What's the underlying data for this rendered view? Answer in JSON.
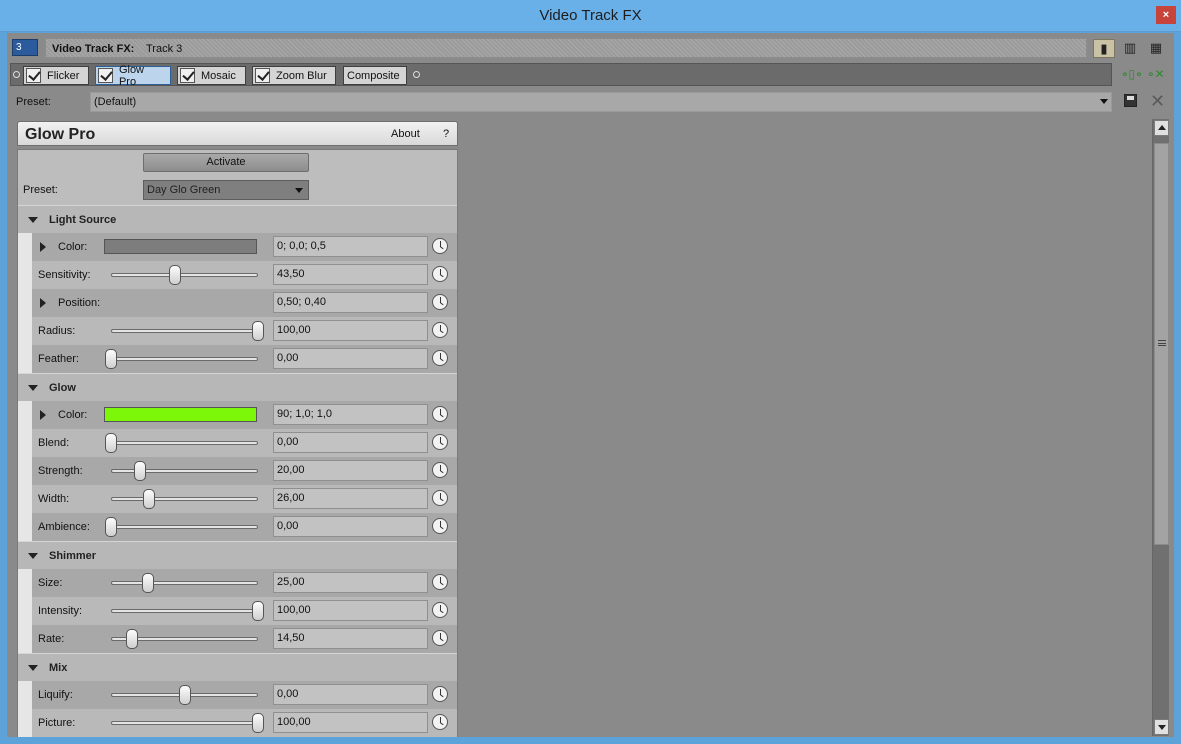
{
  "window": {
    "title": "Video Track FX",
    "close_glyph": "×"
  },
  "header": {
    "track_number": "3",
    "title": "Video Track FX:",
    "track_name": "Track 3"
  },
  "chain": {
    "effects": [
      {
        "label": "Flicker",
        "checked": true,
        "active": false
      },
      {
        "label": "Glow Pro",
        "checked": true,
        "active": true
      },
      {
        "label": "Mosaic",
        "checked": true,
        "active": false
      },
      {
        "label": "Zoom Blur",
        "checked": true,
        "active": false
      },
      {
        "label": "Composite",
        "checked": false,
        "active": false
      }
    ],
    "icons": [
      "plug-in-chain-icon",
      "remove-plugin-icon"
    ]
  },
  "preset_bar": {
    "label": "Preset:",
    "value": "(Default)"
  },
  "plugin": {
    "title": "Glow Pro",
    "about": "About",
    "help": "?",
    "activate": "Activate",
    "preset_label": "Preset:",
    "preset_value": "Day Glo Green",
    "sections": [
      {
        "name": "Light Source",
        "rows": [
          {
            "label": "Color:",
            "type": "color",
            "expandable": true,
            "color": "#7d7d7d",
            "value": "0; 0,0; 0,5"
          },
          {
            "label": "Sensitivity:",
            "type": "slider",
            "fraction": 0.435,
            "value": "43,50"
          },
          {
            "label": "Position:",
            "type": "text",
            "expandable": true,
            "value": "0,50; 0,40"
          },
          {
            "label": "Radius:",
            "type": "slider",
            "fraction": 1.0,
            "value": "100,00"
          },
          {
            "label": "Feather:",
            "type": "slider",
            "fraction": 0.0,
            "value": "0,00"
          }
        ]
      },
      {
        "name": "Glow",
        "rows": [
          {
            "label": "Color:",
            "type": "color",
            "expandable": true,
            "color": "#7cf70a",
            "value": "90; 1,0; 1,0"
          },
          {
            "label": "Blend:",
            "type": "slider",
            "fraction": 0.0,
            "value": "0,00"
          },
          {
            "label": "Strength:",
            "type": "slider",
            "fraction": 0.2,
            "value": "20,00"
          },
          {
            "label": "Width:",
            "type": "slider",
            "fraction": 0.26,
            "value": "26,00"
          },
          {
            "label": "Ambience:",
            "type": "slider",
            "fraction": 0.0,
            "value": "0,00"
          }
        ]
      },
      {
        "name": "Shimmer",
        "rows": [
          {
            "label": "Size:",
            "type": "slider",
            "fraction": 0.25,
            "value": "25,00"
          },
          {
            "label": "Intensity:",
            "type": "slider",
            "fraction": 1.0,
            "value": "100,00"
          },
          {
            "label": "Rate:",
            "type": "slider",
            "fraction": 0.145,
            "value": "14,50"
          }
        ]
      },
      {
        "name": "Mix",
        "rows": [
          {
            "label": "Liquify:",
            "type": "slider",
            "fraction": 0.5,
            "value": "0,00"
          },
          {
            "label": "Picture:",
            "type": "slider",
            "fraction": 1.0,
            "value": "100,00"
          }
        ]
      }
    ]
  }
}
